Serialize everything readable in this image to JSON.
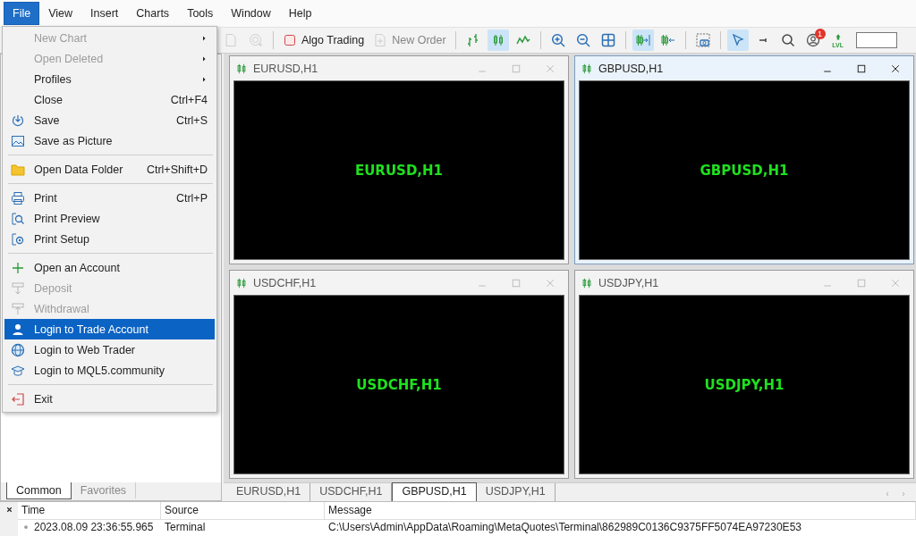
{
  "menu_bar": {
    "items": [
      {
        "label": "File",
        "selected": true
      },
      {
        "label": "View",
        "selected": false
      },
      {
        "label": "Insert",
        "selected": false
      },
      {
        "label": "Charts",
        "selected": false
      },
      {
        "label": "Tools",
        "selected": false
      },
      {
        "label": "Window",
        "selected": false
      },
      {
        "label": "Help",
        "selected": false
      }
    ]
  },
  "file_menu": {
    "groups": [
      {
        "items": [
          {
            "kind": "plain",
            "label": "New Chart",
            "submenu": true,
            "disabled": true,
            "selected": false
          },
          {
            "kind": "plain",
            "label": "Open Deleted",
            "submenu": true,
            "disabled": true,
            "selected": false
          },
          {
            "kind": "plain",
            "label": "Profiles",
            "submenu": true,
            "disabled": false,
            "selected": false
          },
          {
            "kind": "plain",
            "label": "Close",
            "shortcut": "Ctrl+F4",
            "submenu": false,
            "disabled": false,
            "selected": false
          },
          {
            "kind": "save",
            "label": "Save",
            "shortcut": "Ctrl+S",
            "submenu": false,
            "disabled": false,
            "selected": false
          },
          {
            "kind": "picture",
            "label": "Save as Picture",
            "submenu": false,
            "disabled": false,
            "selected": false
          }
        ]
      },
      {
        "items": [
          {
            "kind": "folder",
            "label": "Open Data Folder",
            "shortcut": "Ctrl+Shift+D",
            "submenu": false,
            "disabled": false,
            "selected": false
          }
        ]
      },
      {
        "items": [
          {
            "kind": "print",
            "label": "Print",
            "shortcut": "Ctrl+P",
            "submenu": false,
            "disabled": false,
            "selected": false
          },
          {
            "kind": "preview",
            "label": "Print Preview",
            "submenu": false,
            "disabled": false,
            "selected": false
          },
          {
            "kind": "setup",
            "label": "Print Setup",
            "submenu": false,
            "disabled": false,
            "selected": false
          }
        ]
      },
      {
        "items": [
          {
            "kind": "plus",
            "label": "Open an Account",
            "submenu": false,
            "disabled": false,
            "selected": false
          },
          {
            "kind": "deposit",
            "label": "Deposit",
            "submenu": false,
            "disabled": true,
            "selected": false
          },
          {
            "kind": "withdraw",
            "label": "Withdrawal",
            "submenu": false,
            "disabled": true,
            "selected": false
          },
          {
            "kind": "user",
            "label": "Login to Trade Account",
            "submenu": false,
            "disabled": false,
            "selected": true
          },
          {
            "kind": "globe",
            "label": "Login to Web Trader",
            "submenu": false,
            "disabled": false,
            "selected": false
          },
          {
            "kind": "cap",
            "label": "Login to MQL5.community",
            "submenu": false,
            "disabled": false,
            "selected": false
          }
        ]
      },
      {
        "items": [
          {
            "kind": "exit",
            "label": "Exit",
            "submenu": false,
            "disabled": false,
            "selected": false
          }
        ]
      }
    ]
  },
  "toolbar": {
    "groups": [
      {
        "items": [
          {
            "kind": "document",
            "active": false,
            "disabled": true
          },
          {
            "kind": "target",
            "active": false,
            "disabled": true
          }
        ]
      },
      {
        "items": [
          {
            "kind": "algo",
            "label": "Algo Trading",
            "active": false,
            "disabled": false
          },
          {
            "kind": "order",
            "label": "New Order",
            "active": false,
            "disabled": true
          }
        ]
      },
      {
        "items": [
          {
            "kind": "bars",
            "active": false,
            "disabled": false
          },
          {
            "kind": "candles",
            "active": true,
            "disabled": false
          },
          {
            "kind": "line",
            "active": false,
            "disabled": false
          }
        ]
      },
      {
        "items": [
          {
            "kind": "zoomin",
            "active": false,
            "disabled": false
          },
          {
            "kind": "zoomout",
            "active": false,
            "disabled": false
          },
          {
            "kind": "tile",
            "active": false,
            "disabled": false
          }
        ]
      },
      {
        "items": [
          {
            "kind": "autoscroll",
            "active": true,
            "disabled": false
          },
          {
            "kind": "shift",
            "active": false,
            "disabled": false
          }
        ]
      },
      {
        "items": [
          {
            "kind": "screenshot",
            "active": false,
            "disabled": false
          }
        ]
      },
      {
        "items": [
          {
            "kind": "cursor",
            "active": true,
            "disabled": false
          },
          {
            "kind": "crosshair",
            "active": false,
            "disabled": false
          },
          {
            "kind": "search",
            "active": false,
            "disabled": false
          },
          {
            "kind": "account",
            "badge": "1",
            "active": false,
            "disabled": false
          },
          {
            "kind": "level",
            "label": "LVL",
            "active": false,
            "disabled": false
          }
        ]
      }
    ]
  },
  "navigator": {
    "tabs": [
      {
        "label": "Common",
        "selected": true
      },
      {
        "label": "Favorites",
        "selected": false
      }
    ]
  },
  "charts": [
    {
      "title": "EURUSD,H1",
      "label": "EURUSD,H1",
      "active": false
    },
    {
      "title": "GBPUSD,H1",
      "label": "GBPUSD,H1",
      "active": true
    },
    {
      "title": "USDCHF,H1",
      "label": "USDCHF,H1",
      "active": false
    },
    {
      "title": "USDJPY,H1",
      "label": "USDJPY,H1",
      "active": false
    }
  ],
  "chart_tabs": [
    {
      "label": "EURUSD,H1",
      "selected": false
    },
    {
      "label": "USDCHF,H1",
      "selected": false
    },
    {
      "label": "GBPUSD,H1",
      "selected": true
    },
    {
      "label": "USDJPY,H1",
      "selected": false
    }
  ],
  "terminal": {
    "columns": [
      "Time",
      "Source",
      "Message"
    ],
    "rows": [
      {
        "time": "2023.08.09 23:36:55.965",
        "source": "Terminal",
        "message": "C:\\Users\\Admin\\AppData\\Roaming\\MetaQuotes\\Terminal\\862989C0136C9375FF5074EA97230E53"
      }
    ]
  }
}
